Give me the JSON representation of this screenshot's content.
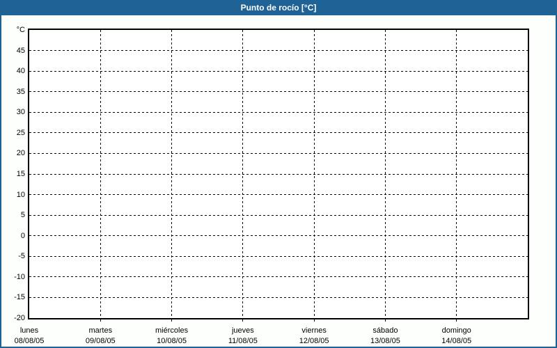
{
  "window": {
    "title": "Punto de rocío [°C]"
  },
  "colors": {
    "header_bg": "#1e6296",
    "header_text": "#ffffff",
    "frame_border": "#1e6296",
    "page_bg": "#fdfffd",
    "plot_bg": "#ffffff",
    "plot_border": "#000000",
    "gridline": "#000000",
    "label_text": "#000000"
  },
  "chart_data": {
    "type": "line",
    "title": "Punto de rocío [°C]",
    "ylabel": "°C",
    "grid": "dashed",
    "legend": "none",
    "y_axis": {
      "unit_label": "°C",
      "min": -20,
      "max": 50,
      "tick_step": 5,
      "tick_labels": [
        45,
        40,
        35,
        30,
        25,
        20,
        15,
        10,
        5,
        0,
        -5,
        -10,
        -15,
        -20
      ]
    },
    "x_axis": {
      "categories": [
        {
          "day": "lunes",
          "date": "08/08/05"
        },
        {
          "day": "martes",
          "date": "09/08/05"
        },
        {
          "day": "miércoles",
          "date": "10/08/05"
        },
        {
          "day": "jueves",
          "date": "11/08/05"
        },
        {
          "day": "viernes",
          "date": "12/08/05"
        },
        {
          "day": "sábado",
          "date": "13/08/05"
        },
        {
          "day": "domingo",
          "date": "14/08/05"
        }
      ]
    },
    "series": []
  }
}
